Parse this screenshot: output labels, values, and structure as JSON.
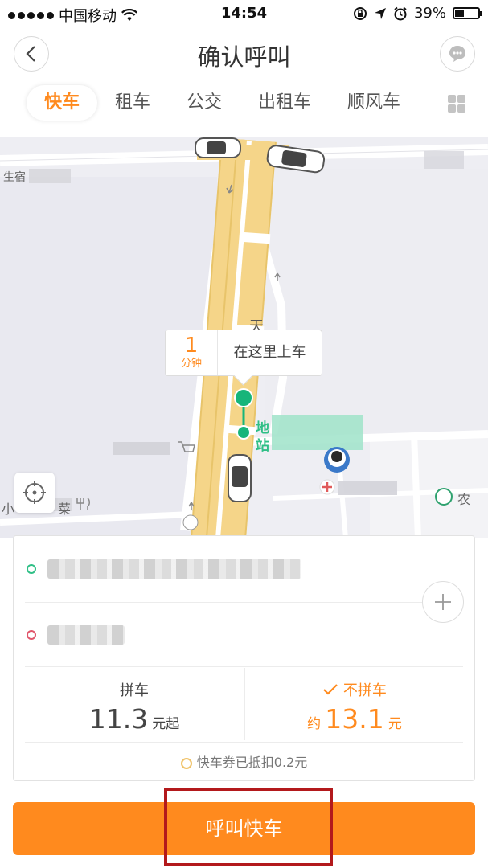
{
  "status_bar": {
    "carrier": "中国移动",
    "time": "14:54",
    "battery_percent": "39%",
    "battery_level": 0.39
  },
  "header": {
    "title": "确认呼叫",
    "back_icon": "chevron-left-icon",
    "message_icon": "chat-bubble-icon"
  },
  "tabs": [
    {
      "label": "快车",
      "active": true
    },
    {
      "label": "租车"
    },
    {
      "label": "公交"
    },
    {
      "label": "出租车"
    },
    {
      "label": "顺风车"
    }
  ],
  "map": {
    "road_label": "天",
    "callout": {
      "eta_number": "1",
      "eta_unit": "分钟",
      "pickup_text": "在这里上车"
    },
    "poi_fragments": {
      "left_top": "生宿",
      "left_bottom_1": "小",
      "left_bottom_2": "菜",
      "station_1": "地",
      "station_2": "站",
      "right_bottom": "农"
    }
  },
  "trip": {
    "from_dot_color": "#2fbf86",
    "to_dot_color": "#e0556a"
  },
  "pricing": {
    "carpool": {
      "label": "拼车",
      "amount": "11.3",
      "unit": "元起"
    },
    "no_carpool": {
      "label": "不拼车",
      "prefix": "约",
      "amount": "13.1",
      "unit": "元",
      "selected": true
    },
    "coupon_text": "快车券已抵扣0.2元"
  },
  "call_button": {
    "label": "呼叫快车"
  },
  "colors": {
    "accent": "#ff8a1e",
    "road": "#f5d589",
    "map_bg": "#eeeef3",
    "pin_green": "#17b57a",
    "highlight_box": "#b3191c"
  }
}
